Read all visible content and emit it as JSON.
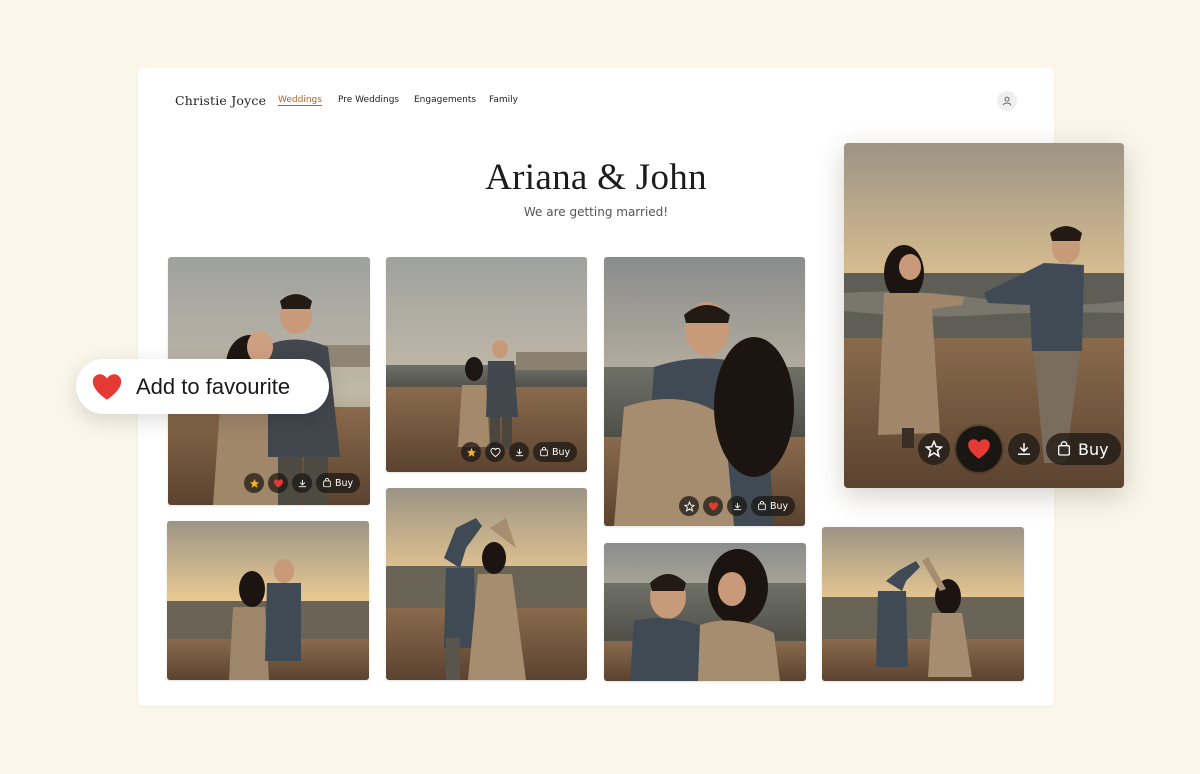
{
  "header": {
    "brand": "Christie Joyce",
    "nav": [
      {
        "label": "Weddings",
        "active": true
      },
      {
        "label": "Pre Weddings",
        "active": false
      },
      {
        "label": "Engagements",
        "active": false
      },
      {
        "label": "Family",
        "active": false
      }
    ],
    "profile_icon": "user-icon"
  },
  "hero": {
    "title": "Ariana & John",
    "subtitle": "We are getting married!"
  },
  "gallery": {
    "photos": [
      {
        "favourited": true,
        "starred": true,
        "actions": [
          "star",
          "heart",
          "download"
        ],
        "buy_label": "Buy"
      },
      {
        "favourited": false,
        "starred": true,
        "actions": [
          "star",
          "heart",
          "download"
        ],
        "buy_label": "Buy"
      },
      {
        "favourited": true,
        "starred": false,
        "actions": [
          "star",
          "heart",
          "download"
        ],
        "buy_label": "Buy"
      },
      {
        "actions": []
      },
      {
        "actions": []
      },
      {
        "actions": []
      },
      {
        "actions": []
      }
    ]
  },
  "preview": {
    "favourited": true,
    "buy_label": "Buy"
  },
  "toast": {
    "label": "Add to favourite",
    "icon": "heart-icon"
  },
  "colors": {
    "page_bg": "#faf6ea",
    "nav_active": "#b5621e",
    "heart": "#e53935",
    "star": "#f5b323"
  }
}
